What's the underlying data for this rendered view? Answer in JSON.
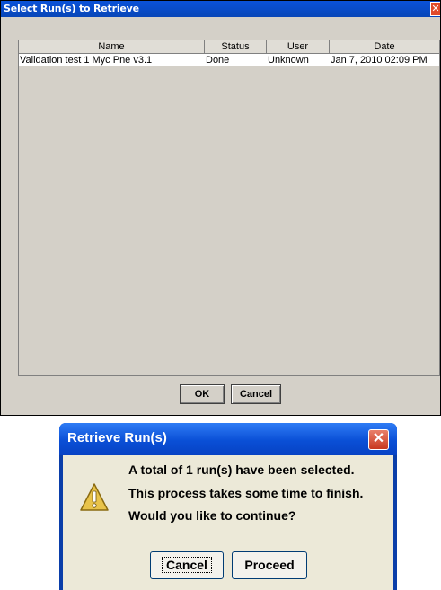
{
  "retrieve_dialog": {
    "title": "Select Run(s) to Retrieve",
    "close_symbol": "✕",
    "columns": [
      "Name",
      "Status",
      "User",
      "Date"
    ],
    "rows": [
      {
        "name": "Validation test 1 Myc Pne v3.1",
        "status": "Done",
        "user": "Unknown",
        "date": "Jan 7, 2010 02:09 PM"
      }
    ],
    "buttons": {
      "ok": "OK",
      "cancel": "Cancel"
    }
  },
  "confirm_dialog": {
    "title": "Retrieve Run(s)",
    "close_symbol": "✕",
    "icon": "warning-icon",
    "message_lines": [
      "A total of 1 run(s) have been selected.",
      "This process takes some time to finish.",
      "Would you like to continue?"
    ],
    "buttons": {
      "cancel": "Cancel",
      "proceed": "Proceed"
    }
  }
}
